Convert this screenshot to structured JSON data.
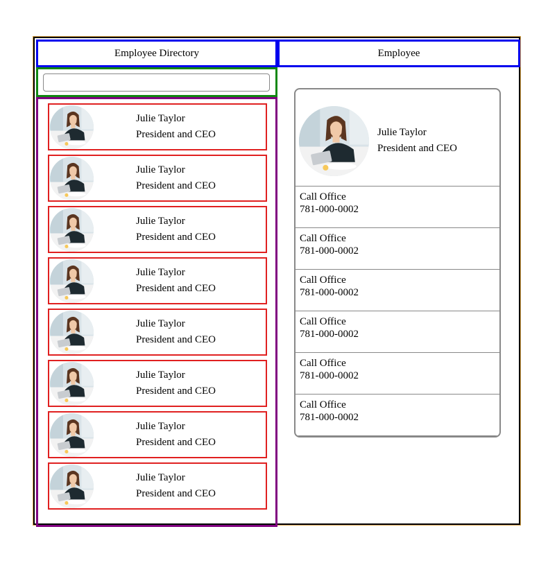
{
  "directory": {
    "header_title": "Employee Directory",
    "search": {
      "value": "",
      "placeholder": ""
    },
    "employees": [
      {
        "name": "Julie Taylor",
        "title": "President and CEO"
      },
      {
        "name": "Julie Taylor",
        "title": "President and CEO"
      },
      {
        "name": "Julie Taylor",
        "title": "President and CEO"
      },
      {
        "name": "Julie Taylor",
        "title": "President and CEO"
      },
      {
        "name": "Julie Taylor",
        "title": "President and CEO"
      },
      {
        "name": "Julie Taylor",
        "title": "President and CEO"
      },
      {
        "name": "Julie Taylor",
        "title": "President and CEO"
      },
      {
        "name": "Julie Taylor",
        "title": "President and CEO"
      }
    ]
  },
  "detail": {
    "header_title": "Employee",
    "employee": {
      "name": "Julie Taylor",
      "title": "President and CEO"
    },
    "actions": [
      {
        "label": "Call Office",
        "value": "781-000-0002"
      },
      {
        "label": "Call Office",
        "value": "781-000-0002"
      },
      {
        "label": "Call Office",
        "value": "781-000-0002"
      },
      {
        "label": "Call Office",
        "value": "781-000-0002"
      },
      {
        "label": "Call Office",
        "value": "781-000-0002"
      },
      {
        "label": "Call Office",
        "value": "781-000-0002"
      }
    ]
  },
  "colors": {
    "header_border": "#0000ee",
    "search_border": "#118811",
    "list_border": "#800080",
    "item_border": "#e02020"
  },
  "icons": {
    "employee_photo": "avatar-photo"
  }
}
